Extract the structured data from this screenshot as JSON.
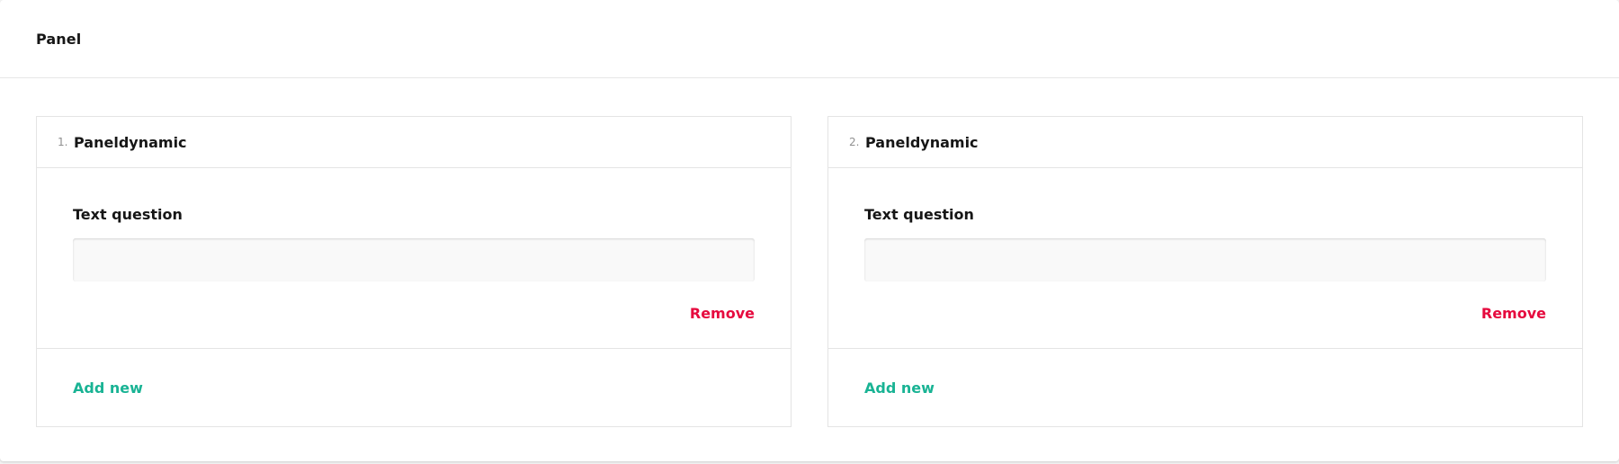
{
  "panel": {
    "title": "Panel"
  },
  "entries": [
    {
      "number": "1.",
      "title": "Paneldynamic",
      "question_label": "Text question",
      "input_value": "",
      "remove_label": "Remove",
      "add_label": "Add new"
    },
    {
      "number": "2.",
      "title": "Paneldynamic",
      "question_label": "Text question",
      "input_value": "",
      "remove_label": "Remove",
      "add_label": "Add new"
    }
  ],
  "colors": {
    "remove": "#e60a3e",
    "add": "#19b394",
    "text": "#161616",
    "border": "#e4e4e4",
    "input_bg": "#f9f9f9"
  }
}
